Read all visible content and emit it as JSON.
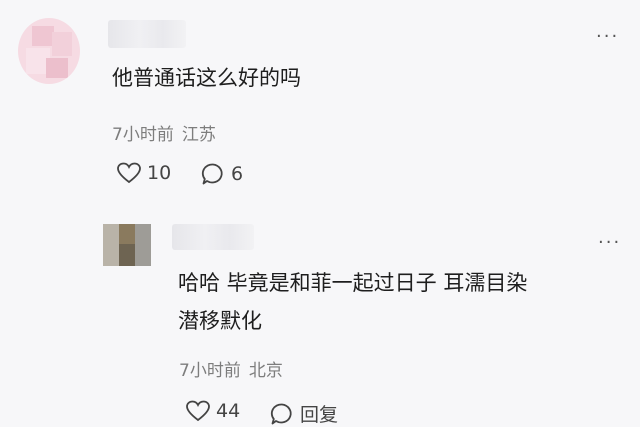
{
  "comments": [
    {
      "text": [
        "他普通话这么好的吗"
      ],
      "time": "7小时前",
      "location": "江苏",
      "likes": "10",
      "replies": "6",
      "more_icon": "more-dots-icon"
    },
    {
      "text": [
        "哈哈 毕竟是和菲一起过日子 耳濡目染",
        "潜移默化"
      ],
      "time": "7小时前",
      "location": "北京",
      "likes": "44",
      "reply_label": "回复",
      "more_icon": "more-dots-icon"
    }
  ]
}
